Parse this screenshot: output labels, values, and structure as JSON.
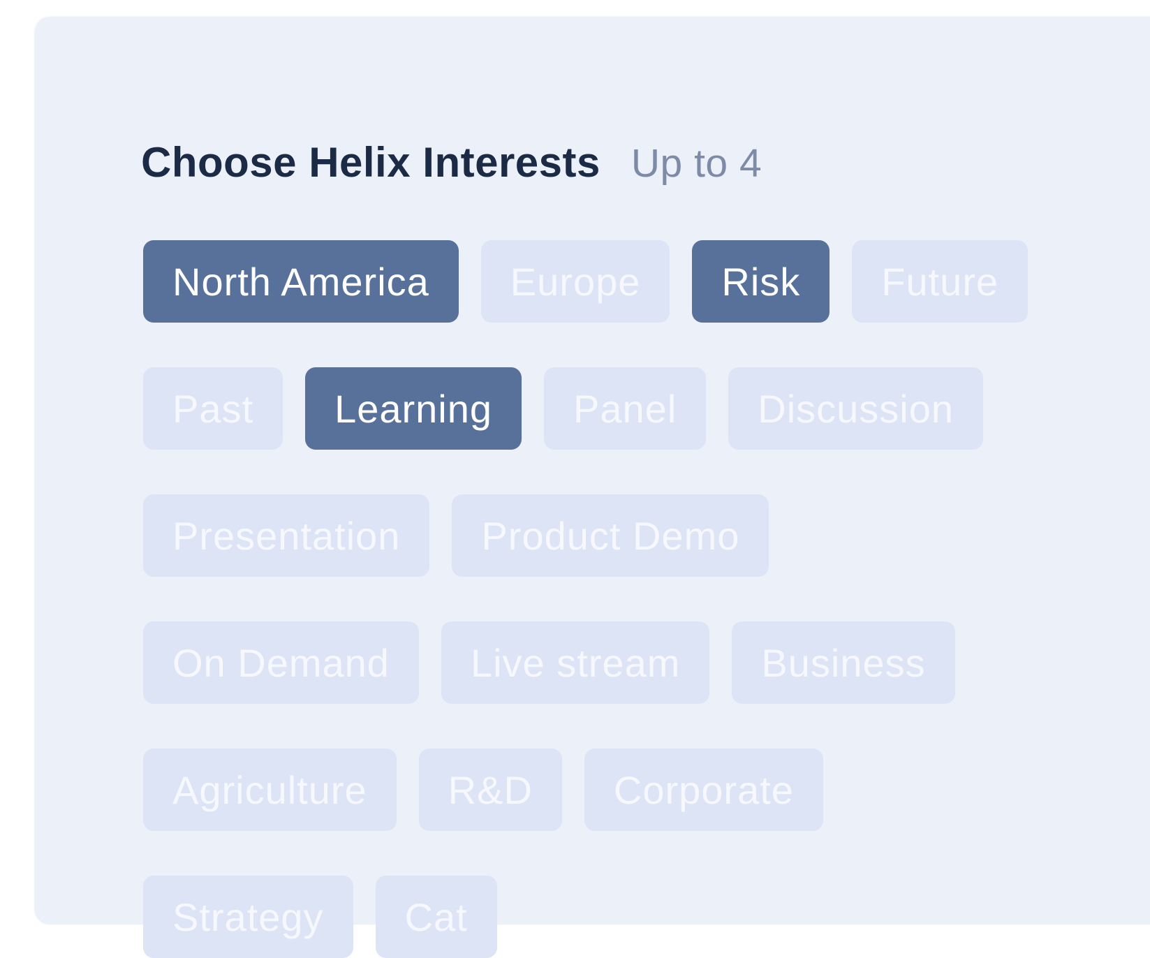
{
  "header": {
    "title": "Choose Helix Interests",
    "limit": "Up to 4"
  },
  "colors": {
    "selected_chip": "#58719a",
    "unselected_chip": "#dde4f6",
    "card_background": "#ecf0f9"
  },
  "chips": [
    {
      "label": "North America",
      "selected": true
    },
    {
      "label": "Europe",
      "selected": false
    },
    {
      "label": "Risk",
      "selected": true
    },
    {
      "label": "Future",
      "selected": false
    },
    {
      "label": "Past",
      "selected": false
    },
    {
      "label": "Learning",
      "selected": true
    },
    {
      "label": "Panel",
      "selected": false
    },
    {
      "label": "Discussion",
      "selected": false
    },
    {
      "label": "Presentation",
      "selected": false
    },
    {
      "label": "Product Demo",
      "selected": false
    },
    {
      "label": "On Demand",
      "selected": false
    },
    {
      "label": "Live stream",
      "selected": false
    },
    {
      "label": "Business",
      "selected": false
    },
    {
      "label": "Agriculture",
      "selected": false
    },
    {
      "label": "R&D",
      "selected": false
    },
    {
      "label": "Corporate",
      "selected": false
    },
    {
      "label": "Strategy",
      "selected": false
    },
    {
      "label": "Cat",
      "selected": false
    }
  ]
}
